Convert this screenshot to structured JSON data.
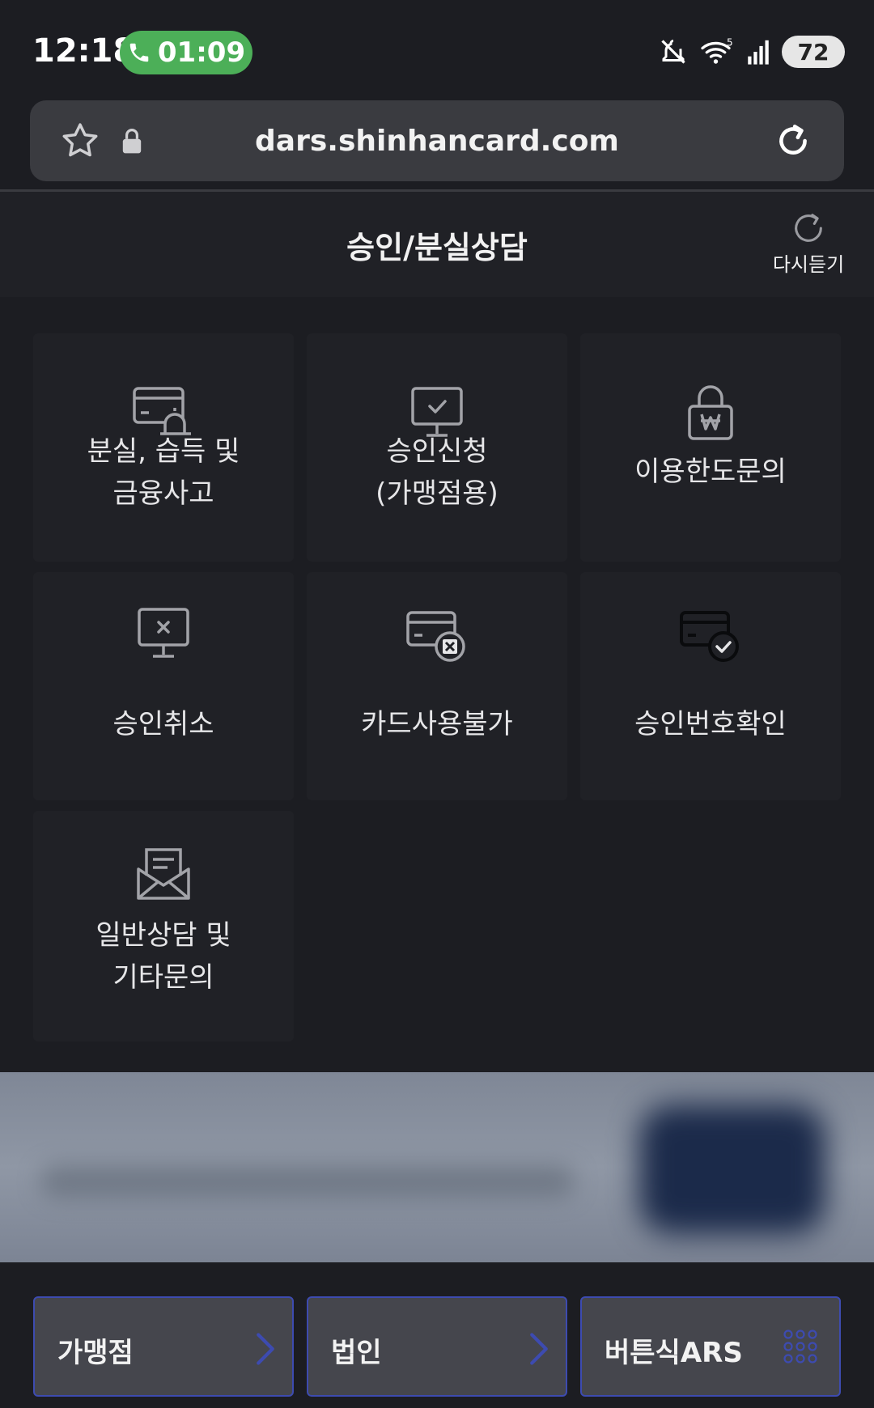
{
  "status_bar": {
    "time": "12:18",
    "call_timer": "01:09",
    "battery": "72"
  },
  "url_bar": {
    "url": "dars.shinhancard.com"
  },
  "header": {
    "title": "승인/분실상담",
    "replay_label": "다시듣기"
  },
  "menu": {
    "tiles": [
      {
        "line1": "분실, 습득 및",
        "line2": "금융사고",
        "icon": "card-alarm-icon"
      },
      {
        "line1": "승인신청",
        "line2": "(가맹점용)",
        "icon": "monitor-check-icon"
      },
      {
        "line1": "이용한도문의",
        "line2": "",
        "icon": "lock-won-icon"
      },
      {
        "line1": "승인취소",
        "line2": "",
        "icon": "monitor-x-icon"
      },
      {
        "line1": "카드사용불가",
        "line2": "",
        "icon": "card-x-icon"
      },
      {
        "line1": "승인번호확인",
        "line2": "",
        "icon": "card-check-icon"
      },
      {
        "line1": "일반상담 및",
        "line2": "기타문의",
        "icon": "envelope-icon"
      }
    ]
  },
  "bottom_bar": {
    "merchant_label": "가맹점",
    "corporate_label": "법인",
    "button_ars_label": "버튼식ARS"
  },
  "colors": {
    "background": "#1c1d22",
    "tile": "#202126",
    "call_green": "#4caf58",
    "button_border": "#3d4bb0"
  }
}
